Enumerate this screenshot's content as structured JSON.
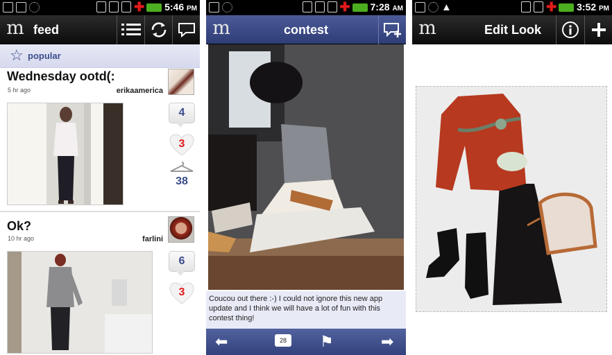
{
  "screens": {
    "feed": {
      "status": {
        "time": "5:46",
        "ampm": "PM"
      },
      "appbar": {
        "title": "feed",
        "list_icon": "list-icon",
        "refresh_icon": "refresh-icon",
        "message_icon": "message-icon"
      },
      "filter": {
        "label": "popular",
        "icon": "star-icon"
      },
      "posts": [
        {
          "title": "Wednesday ootd(:",
          "time": "5 hr ago",
          "user": "erikaamerica",
          "comments": "4",
          "likes": "3",
          "saves": "38"
        },
        {
          "title": "Ok?",
          "time": "10 hr ago",
          "user": "farlini",
          "comments": "6",
          "likes": "3"
        }
      ]
    },
    "contest": {
      "status": {
        "time": "7:28",
        "ampm": "AM"
      },
      "appbar": {
        "title": "contest",
        "add_icon": "add-comment-icon"
      },
      "caption": "Coucou out there :-) I could not ignore this new app update and I think we will have a lot of fun with this contest thing!",
      "bottom": {
        "count": "28",
        "back_icon": "arrow-left-icon",
        "flag_icon": "flag-icon",
        "next_icon": "arrow-right-icon"
      }
    },
    "edit": {
      "status": {
        "time": "3:52",
        "ampm": "PM"
      },
      "appbar": {
        "title": "Edit Look",
        "info_icon": "info-icon",
        "add_icon": "plus-icon"
      }
    }
  },
  "colors": {
    "accent": "#3b4d8c",
    "like": "#e21a1a",
    "bar_dark": "#111111"
  }
}
